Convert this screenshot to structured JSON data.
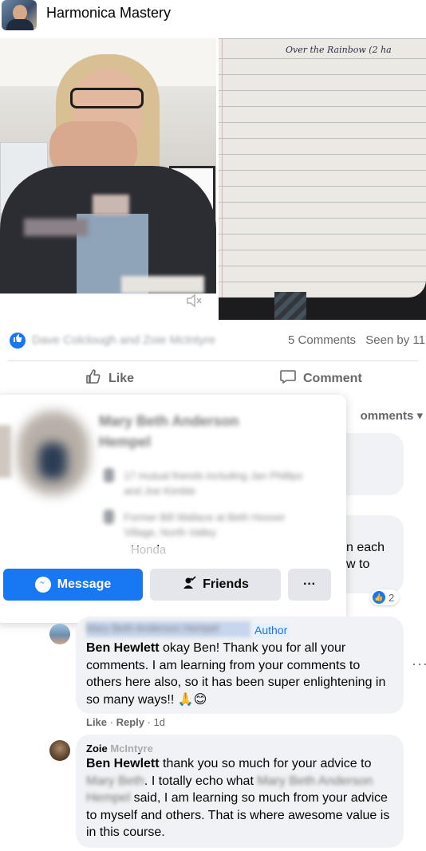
{
  "group": {
    "title": "Harmonica Mastery"
  },
  "media": {
    "handwriting": "Over the Rainbow (2 ha"
  },
  "reactions": {
    "reactors": "Dave Colclough and Zoie McIntyre",
    "comments_count": "5 Comments",
    "seen_by": "Seen by 11"
  },
  "actions": {
    "like": "Like",
    "comment": "Comment"
  },
  "comments_sort": {
    "label": "omments"
  },
  "profile_popup": {
    "name": "Mary Beth Anderson Hempel",
    "detail_1": "17 mutual friends including Jan Phillips and Joe Kimble",
    "detail_2": "Former Bill Wallace at Beth Hoover Village, North Valley",
    "honda": "Honda",
    "message_button": "Message",
    "friends_button": "Friends",
    "more_button": "···"
  },
  "partial_comment": {
    "line1": "n each",
    "line2": "w to",
    "reaction_count": "2"
  },
  "comment_reply_1": {
    "author_blurred": "Mary Beth Anderson Hempel",
    "author_badge": "Author",
    "mention": "Ben Hewlett",
    "text": " okay Ben! Thank you for all your comments. I am learning from your comments to others here also, so it has been super enlightening in so many ways!! 🙏😊",
    "like": "Like",
    "reply": "Reply",
    "time": "1d"
  },
  "comment_reply_2": {
    "author": "Zoie McIntyre",
    "mention": "Ben Hewlett",
    "text_part1": " thank you so much for your advice to ",
    "blur_1": "Mary Beth",
    "text_part2": ". I totally echo what ",
    "blur_2": "Mary Beth Anderson Hempel",
    "text_part3": " said, I am learning so much from your advice to myself and others. That is where awesome value is in this course."
  },
  "colors": {
    "accent": "#1877f2",
    "bubble": "#f0f2f5",
    "muted_text": "#65676b"
  },
  "icons": {
    "like_badge": "thumbs-up-icon",
    "mute": "speaker-mute-icon",
    "like_action": "thumbs-up-outline-icon",
    "comment_action": "speech-bubble-icon",
    "messenger": "messenger-icon",
    "friends": "person-check-icon",
    "more": "more-dots-icon"
  }
}
